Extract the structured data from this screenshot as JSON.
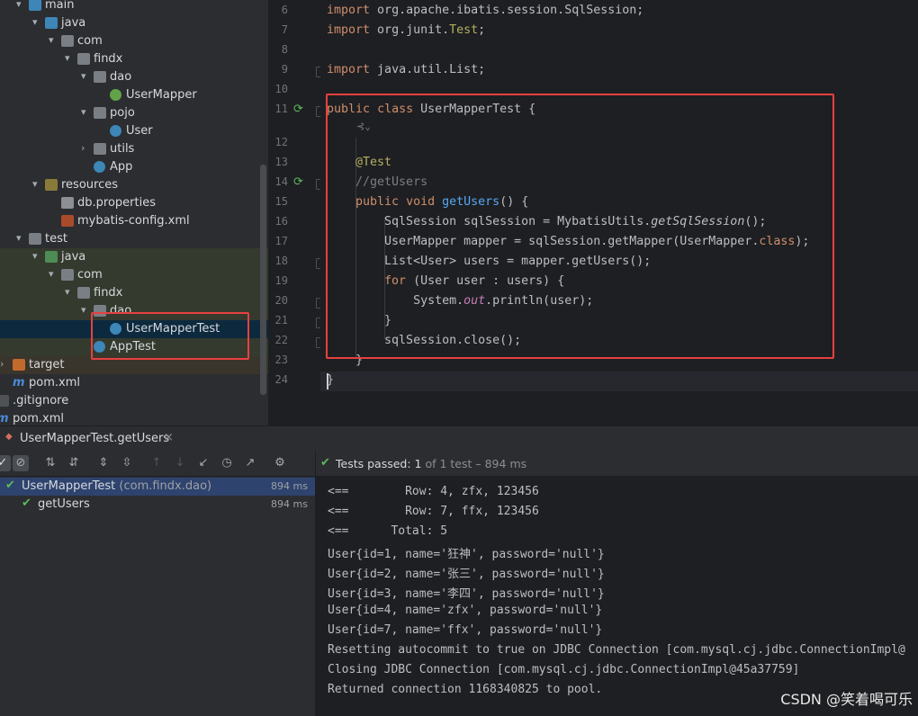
{
  "project_tree": [
    {
      "label": "main",
      "indent": 18,
      "chev": "▾",
      "icon": "ic-folder-src",
      "name": "tree-main"
    },
    {
      "label": "java",
      "indent": 36,
      "chev": "▾",
      "icon": "ic-folder-src",
      "name": "tree-java-main"
    },
    {
      "label": "com",
      "indent": 54,
      "chev": "▾",
      "icon": "ic-folder",
      "name": "tree-com-main"
    },
    {
      "label": "findx",
      "indent": 72,
      "chev": "▾",
      "icon": "ic-folder",
      "name": "tree-findx-main"
    },
    {
      "label": "dao",
      "indent": 90,
      "chev": "▾",
      "icon": "ic-folder",
      "name": "tree-dao-main"
    },
    {
      "label": "UserMapper",
      "indent": 108,
      "chev": "",
      "icon": "ic-interface ic-circle",
      "name": "tree-usermapper"
    },
    {
      "label": "pojo",
      "indent": 90,
      "chev": "▾",
      "icon": "ic-folder",
      "name": "tree-pojo"
    },
    {
      "label": "User",
      "indent": 108,
      "chev": "",
      "icon": "ic-class ic-circle",
      "name": "tree-user"
    },
    {
      "label": "utils",
      "indent": 90,
      "chev": "›",
      "icon": "ic-folder",
      "name": "tree-utils"
    },
    {
      "label": "App",
      "indent": 90,
      "chev": "",
      "icon": "ic-app ic-circle",
      "name": "tree-app"
    },
    {
      "label": "resources",
      "indent": 36,
      "chev": "▾",
      "icon": "ic-folder-res",
      "name": "tree-resources"
    },
    {
      "label": "db.properties",
      "indent": 54,
      "chev": "",
      "icon": "ic-props",
      "name": "tree-db-properties"
    },
    {
      "label": "mybatis-config.xml",
      "indent": 54,
      "chev": "",
      "icon": "ic-xml",
      "name": "tree-mybatis-config"
    },
    {
      "label": "test",
      "indent": 18,
      "chev": "▾",
      "icon": "ic-folder",
      "name": "tree-test"
    },
    {
      "label": "java",
      "indent": 36,
      "chev": "▾",
      "icon": "ic-folder-test",
      "name": "tree-java-test",
      "hl": "testhl"
    },
    {
      "label": "com",
      "indent": 54,
      "chev": "▾",
      "icon": "ic-folder",
      "name": "tree-com-test",
      "hl": "testhl"
    },
    {
      "label": "findx",
      "indent": 72,
      "chev": "▾",
      "icon": "ic-folder",
      "name": "tree-findx-test",
      "hl": "testhl"
    },
    {
      "label": "dao",
      "indent": 90,
      "chev": "▾",
      "icon": "ic-folder",
      "name": "tree-dao-test",
      "hl": "testhl"
    },
    {
      "label": "UserMapperTest",
      "indent": 108,
      "chev": "",
      "icon": "ic-class ic-circle",
      "name": "tree-usermappertest",
      "hl": "sel"
    },
    {
      "label": "AppTest",
      "indent": 90,
      "chev": "",
      "icon": "ic-class ic-circle",
      "name": "tree-apptest",
      "hl": "testhl"
    },
    {
      "label": "target",
      "indent": 0,
      "chev": "›",
      "icon": "ic-folder-target",
      "name": "tree-target",
      "hl": "targethl"
    },
    {
      "label": "pom.xml",
      "indent": 0,
      "chev": "",
      "icon": "ic-m",
      "icon_text": "m",
      "name": "tree-pom-inner"
    },
    {
      "label": ".gitignore",
      "indent": -18,
      "chev": "",
      "icon": "ic-git",
      "name": "tree-gitignore"
    },
    {
      "label": "pom.xml",
      "indent": -18,
      "chev": "",
      "icon": "ic-m",
      "icon_text": "m",
      "name": "tree-pom-root"
    }
  ],
  "editor": {
    "line_numbers": [
      "6",
      "7",
      "8",
      "9",
      "10",
      "11",
      "12",
      "13",
      "14",
      "15",
      "16",
      "17",
      "18",
      "19",
      "20",
      "21",
      "22",
      "23",
      "24"
    ],
    "lines": [
      "import org.apache.ibatis.session.SqlSession;",
      "import org.junit.Test;",
      "",
      "import java.util.List;",
      "",
      "public class UserMapperTest {",
      "",
      "    @Test",
      "    //getUsers",
      "    public void getUsers() {",
      "        SqlSession sqlSession = MybatisUtils.getSqlSession();",
      "        UserMapper mapper = sqlSession.getMapper(UserMapper.class);",
      "        List<User> users = mapper.getUsers();",
      "        for (User user : users) {",
      "            System.out.println(user);",
      "        }",
      "        sqlSession.close();",
      "    }",
      "}"
    ],
    "inlay_hint": "⊰⌄"
  },
  "run_panel": {
    "tab_title": "UserMapperTest.getUsers",
    "status": {
      "label": "Tests passed: ",
      "passed": "1",
      "rest": " of 1 test – 894 ms"
    },
    "results": [
      {
        "label": "UserMapperTest",
        "pkg": " (com.findx.dao)",
        "time": "894 ms",
        "icon": "check-icon"
      },
      {
        "label": "getUsers",
        "pkg": "",
        "time": "894 ms",
        "icon": "check-icon"
      }
    ],
    "console": [
      "<==        Row: 4, zfx, 123456",
      "<==        Row: 7, ffx, 123456",
      "<==      Total: 5",
      "User{id=1, name='狂神', password='null'}",
      "User{id=2, name='张三', password='null'}",
      "User{id=3, name='李四', password='null'}",
      "User{id=4, name='zfx', password='null'}",
      "User{id=7, name='ffx', password='null'}",
      "Resetting autocommit to true on JDBC Connection [com.mysql.cj.jdbc.ConnectionImpl@",
      "Closing JDBC Connection [com.mysql.cj.jdbc.ConnectionImpl@45a37759]",
      "Returned connection 1168340825 to pool."
    ]
  },
  "watermark": "CSDN @笑着喝可乐",
  "colors": {
    "accent_red": "#e84040",
    "pass_green": "#5fb85f"
  }
}
